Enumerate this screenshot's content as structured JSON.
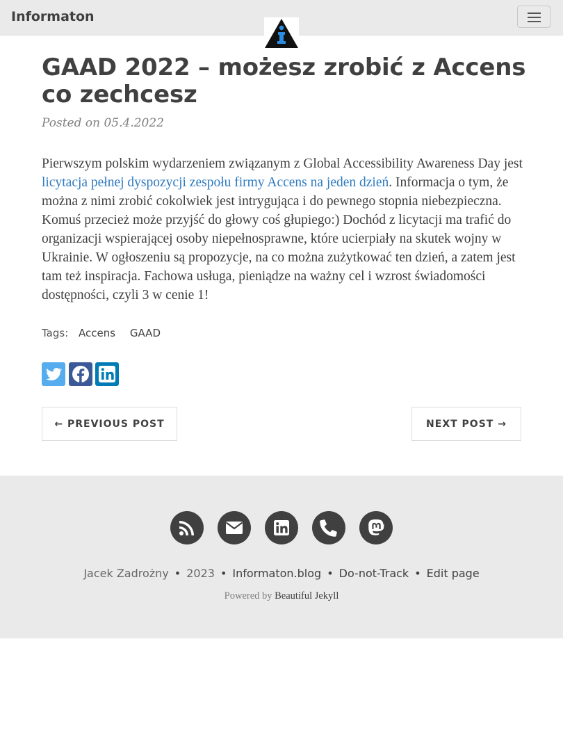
{
  "navbar": {
    "brand": "Informaton",
    "menu_icon": "hamburger-menu-icon",
    "logo_icon": "info-triangle-logo"
  },
  "post": {
    "title": "GAAD 2022 – możesz zrobić z Accens co zechcesz",
    "posted_on": "Posted on 05.4.2022",
    "body_before_link": "Pierwszym polskim wydarzeniem związanym z Global Accessibility Awareness Day jest ",
    "link_text": "licytacja pełnej dyspozycji zespołu firmy Accens na jeden dzień",
    "body_after_link": ". Informacja o tym, że można z nimi zrobić cokolwiek jest intrygująca i do pewnego stopnia niebezpieczna. Komuś przecież może przyjść do głowy coś głupiego:) Dochód z licytacji ma trafić do organizacji wspierającej osoby niepełnosprawne, które ucierpiały na skutek wojny w Ukrainie. W ogłoszeniu są propozycje, na co można zużytkować ten dzień, a zatem jest tam też inspiracja. Fachowa usługa, pieniądze na ważny cel i wzrost świadomości dostępności, czyli 3 w cenie 1!",
    "tags_label": "Tags:",
    "tags": [
      "Accens",
      "GAAD"
    ]
  },
  "share": {
    "twitter_icon": "twitter-icon",
    "facebook_icon": "facebook-icon",
    "linkedin_icon": "linkedin-icon"
  },
  "pager": {
    "previous": "← PREVIOUS POST",
    "next": "NEXT POST →"
  },
  "footer": {
    "icons": [
      "rss-icon",
      "envelope-icon",
      "linkedin-icon",
      "phone-icon",
      "mastodon-icon"
    ],
    "author": "Jacek Zadrożny",
    "year": "2023",
    "site": "Informaton.blog",
    "dnt": "Do-not-Track",
    "edit": "Edit page",
    "separator": "•",
    "powered_prefix": "Powered by",
    "powered_link": "Beautiful Jekyll"
  },
  "colors": {
    "navbar_bg": "#eaeaea",
    "text": "#404040",
    "link": "#2f7bc0",
    "twitter": "#55acee",
    "facebook": "#3b5998",
    "linkedin": "#007bb5",
    "footer_icon_bg": "#404040"
  }
}
